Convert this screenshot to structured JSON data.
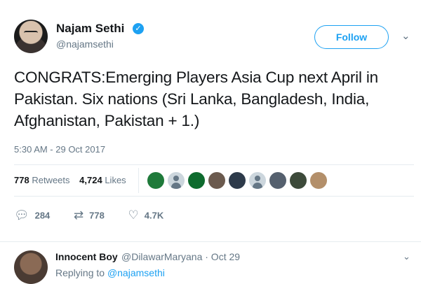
{
  "tweet": {
    "author_name": "Najam Sethi",
    "author_handle": "@najamsethi",
    "follow_label": "Follow",
    "text": "CONGRATS:Emerging Players Asia Cup next April in Pakistan. Six nations (Sri Lanka, Bangladesh, India, Afghanistan, Pakistan + 1.)",
    "timestamp": "5:30 AM - 29 Oct 2017",
    "retweet_count": "778",
    "retweets_label": "Retweets",
    "like_count": "4,724",
    "likes_label": "Likes"
  },
  "liker_avatars": [
    {
      "icon": "avatar-green-flag",
      "color": "#1f7a3a"
    },
    {
      "icon": "avatar-default",
      "color": "#ccd6dd"
    },
    {
      "icon": "avatar-green-logo",
      "color": "#0e6b2e"
    },
    {
      "icon": "avatar-photo",
      "color": "#6b5a4e"
    },
    {
      "icon": "avatar-photo",
      "color": "#2d3a4a"
    },
    {
      "icon": "avatar-default",
      "color": "#ccd6dd"
    },
    {
      "icon": "avatar-photo",
      "color": "#55606e"
    },
    {
      "icon": "avatar-photo",
      "color": "#3d4a3a"
    },
    {
      "icon": "avatar-photo",
      "color": "#b38f6a"
    }
  ],
  "actions": {
    "reply_count": "284",
    "retweet_count": "778",
    "like_count": "4.7K"
  },
  "reply": {
    "author_name": "Innocent Boy",
    "author_handle": "@DilawarMaryana · Oct 29",
    "replying_prefix": "Replying to",
    "replying_to": "@najamsethi"
  },
  "colors": {
    "accent": "#1da1f2",
    "muted_text": "#657786",
    "divider": "#e6ecf0"
  }
}
